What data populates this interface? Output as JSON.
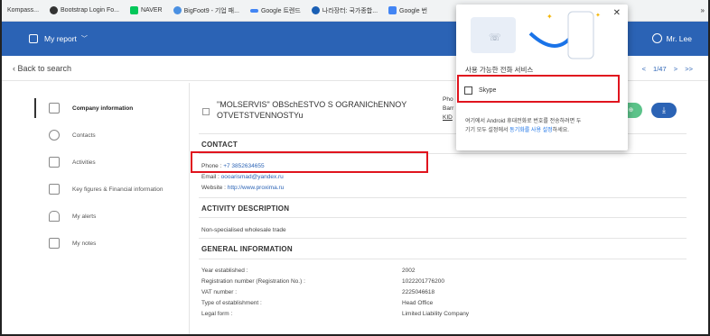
{
  "bookmarks": [
    {
      "label": "Kompass...",
      "icon": "kompass-icon",
      "color": "#ffffff"
    },
    {
      "label": "Bootstrap Login Fo...",
      "icon": "bootstrap-icon",
      "color": "#333333"
    },
    {
      "label": "NAVER",
      "icon": "naver-icon",
      "color": "#03c75a"
    },
    {
      "label": "BigFoot9 - 기업 패...",
      "icon": "bigfoot-icon",
      "color": "#4a90e2"
    },
    {
      "label": "Google 트렌드",
      "icon": "trends-icon",
      "color": "#4285f4"
    },
    {
      "label": "나라장터: 국가종합...",
      "icon": "narajangteo-icon",
      "color": "#1a5fb4"
    },
    {
      "label": "Google 번",
      "icon": "translate-icon",
      "color": "#4285f4"
    }
  ],
  "bookmarks_more": "»",
  "header": {
    "report_label": "My report",
    "user_name": "Mr. Lee"
  },
  "nav": {
    "back_label": "Back to search",
    "pager_first": "<",
    "pager_prev": "<",
    "pager_text": "1/47",
    "pager_next": ">",
    "pager_last": ">>"
  },
  "sidebar": {
    "items": [
      {
        "label": "Company information",
        "icon": "company-icon"
      },
      {
        "label": "Contacts",
        "icon": "contacts-icon"
      },
      {
        "label": "Activities",
        "icon": "activities-icon"
      },
      {
        "label": "Key figures & Financial information",
        "icon": "chart-icon"
      },
      {
        "label": "My alerts",
        "icon": "bell-icon"
      },
      {
        "label": "My notes",
        "icon": "notes-icon"
      }
    ]
  },
  "company": {
    "name": "\"MOLSERVIS\" OBSchESTVO S OGRANIChENNOY OTVETSTVENNOSTYu",
    "phone_clip": "Pho",
    "bar_clip": "Barr",
    "kid_clip": "KID"
  },
  "actions": {
    "list_label": "List ⊕",
    "download_label": "⤓"
  },
  "contact": {
    "title": "CONTACT",
    "phone_label": "Phone : ",
    "phone_value": "+7 3852634655",
    "email_label": "Email : ",
    "email_value": "oooarismad@yandex.ru",
    "website_label": "Website : ",
    "website_value": "http://www.proxima.ru"
  },
  "activity": {
    "title": "ACTIVITY DESCRIPTION",
    "text": "Non-specialised wholesale trade"
  },
  "general": {
    "title": "GENERAL INFORMATION",
    "rows": [
      {
        "label": "Year established :",
        "value": "2002"
      },
      {
        "label": "Registration number (Registration No.) :",
        "value": "1022201776200"
      },
      {
        "label": "VAT number :",
        "value": "2225046618"
      },
      {
        "label": "Type of establishment :",
        "value": "Head Office"
      },
      {
        "label": "Legal form :",
        "value": "Limited Liability Company"
      }
    ]
  },
  "popup": {
    "title": "사용 가능한 전화 서비스",
    "option": "Skype",
    "desc_1": "여기에서 Android 휴대전화로 번호를 전송하려면 두",
    "desc_2a": "기기 모두 설정에서 ",
    "desc_2b": "동기화를 사용 설정",
    "desc_2c": "하세요.",
    "close": "✕"
  }
}
